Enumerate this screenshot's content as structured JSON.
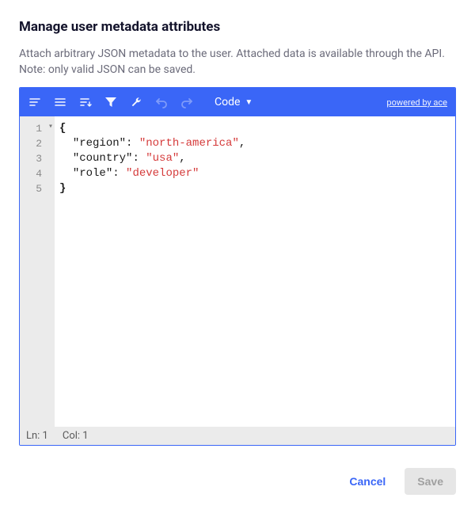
{
  "title": "Manage user metadata attributes",
  "description": "Attach arbitrary JSON metadata to the user. Attached data is available through the API.",
  "note": "Note: only valid JSON can be saved.",
  "toolbar": {
    "mode_label": "Code",
    "powered_label": "powered by ace"
  },
  "editor": {
    "gutter_lines": [
      "1",
      "2",
      "3",
      "4",
      "5"
    ],
    "json": {
      "region": "north-america",
      "country": "usa",
      "role": "developer"
    }
  },
  "status": {
    "line_label": "Ln: 1",
    "col_label": "Col: 1"
  },
  "footer": {
    "cancel_label": "Cancel",
    "save_label": "Save"
  }
}
